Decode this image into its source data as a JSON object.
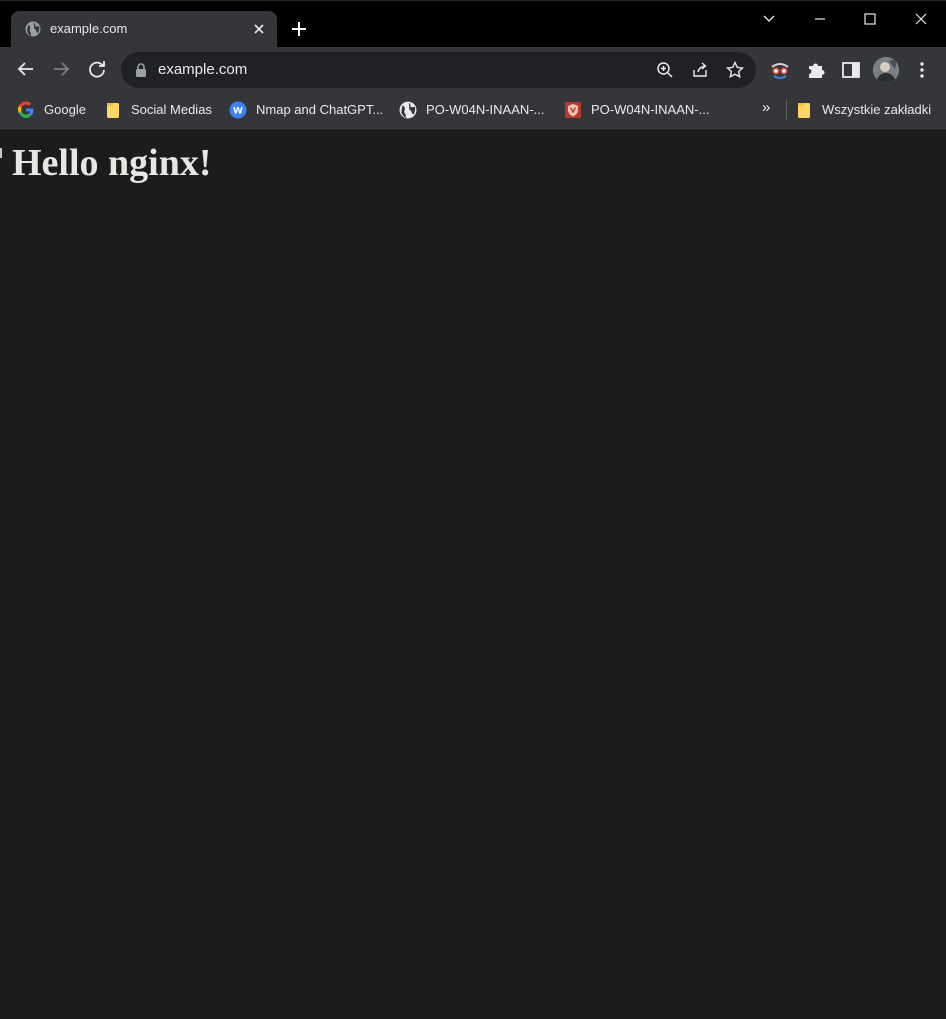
{
  "tab": {
    "title": "example.com",
    "favicon": "globe-icon"
  },
  "toolbar": {
    "url": "example.com",
    "back": "back-arrow-icon",
    "forward": "forward-arrow-icon",
    "reload": "reload-icon"
  },
  "bookmarks": {
    "items": [
      {
        "label": "Google",
        "icon": "google-icon"
      },
      {
        "label": "Social Medias",
        "icon": "folder-icon"
      },
      {
        "label": "Nmap and ChatGPT...",
        "icon": "w-app-icon"
      },
      {
        "label": "PO-W04N-INAAN-...",
        "icon": "globe-icon"
      },
      {
        "label": "PO-W04N-INAAN-...",
        "icon": "shield-icon"
      }
    ],
    "overflow": "»",
    "all_bookmarks": "Wszystkie zakładki"
  },
  "page": {
    "heading": "Hello nginx!"
  },
  "colors": {
    "titlebar": "#000000",
    "toolbar": "#35363a",
    "omnibox": "#202124",
    "page_bg": "#1b1c1b",
    "text": "#e8eaed"
  }
}
